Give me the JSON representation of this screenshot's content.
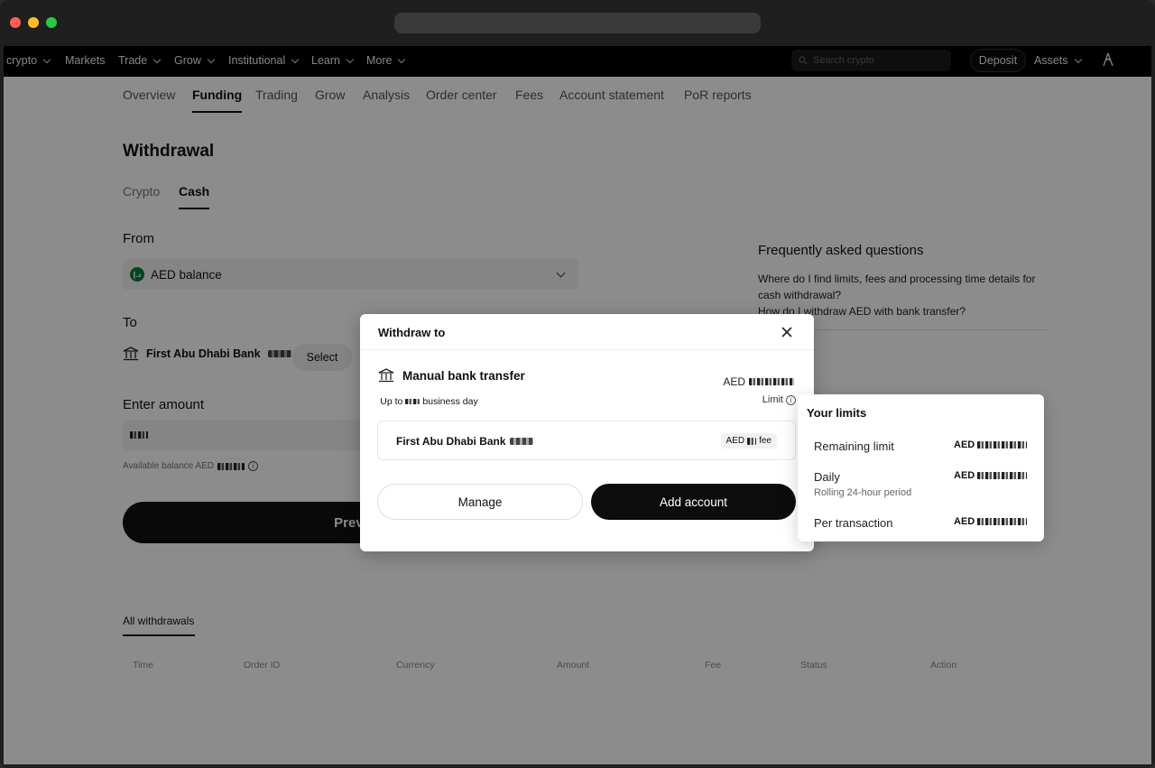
{
  "nav": {
    "items": [
      {
        "label": "crypto",
        "has_menu": true
      },
      {
        "label": "Markets",
        "has_menu": false
      },
      {
        "label": "Trade",
        "has_menu": true
      },
      {
        "label": "Grow",
        "has_menu": true
      },
      {
        "label": "Institutional",
        "has_menu": true
      },
      {
        "label": "Learn",
        "has_menu": true
      },
      {
        "label": "More",
        "has_menu": true
      }
    ],
    "search_placeholder": "Search crypto",
    "deposit_label": "Deposit",
    "assets_label": "Assets"
  },
  "subtabs": [
    {
      "label": "Overview",
      "active": false
    },
    {
      "label": "Funding",
      "active": true
    },
    {
      "label": "Trading",
      "active": false
    },
    {
      "label": "Grow",
      "active": false
    },
    {
      "label": "Analysis",
      "active": false
    },
    {
      "label": "Order center",
      "active": false
    },
    {
      "label": "Fees",
      "active": false
    },
    {
      "label": "Account statement",
      "active": false
    },
    {
      "label": "PoR reports",
      "active": false
    }
  ],
  "withdrawal": {
    "title": "Withdrawal",
    "tabs": [
      {
        "label": "Crypto",
        "active": false
      },
      {
        "label": "Cash",
        "active": true
      }
    ],
    "from_label": "From",
    "from_value": "AED balance",
    "to_label": "To",
    "to_bank": "First Abu Dhabi Bank",
    "select_label": "Select",
    "amount_label": "Enter amount",
    "available_label": "Available balance AED",
    "preview_label": "Previ"
  },
  "faq": {
    "title": "Frequently asked questions",
    "questions": [
      "Where do I find limits, fees and processing time details for cash withdrawal?",
      "How do I withdraw AED with bank transfer?"
    ]
  },
  "history": {
    "tab_label": "All withdrawals",
    "columns": [
      "Time",
      "Order ID",
      "Currency",
      "Amount",
      "Fee",
      "Status",
      "Action"
    ]
  },
  "modal": {
    "title": "Withdraw to",
    "method": "Manual bank transfer",
    "method_currency": "AED",
    "limit_label": "Limit",
    "bank_name": "First Abu Dhabi Bank",
    "fee_currency": "AED",
    "fee_label": "fee",
    "manage_label": "Manage",
    "add_account_label": "Add account"
  },
  "tooltip": {
    "prefix": "Up to",
    "suffix": "business day"
  },
  "limits": {
    "title": "Your limits",
    "rows": [
      {
        "label": "Remaining limit",
        "sub": "",
        "currency": "AED"
      },
      {
        "label": "Daily",
        "sub": "Rolling 24-hour period",
        "currency": "AED"
      },
      {
        "label": "Per transaction",
        "sub": "",
        "currency": "AED"
      }
    ]
  },
  "colors": {
    "primary": "#0c0c0c",
    "overlay": "#000000",
    "aed_badge": "#0f7a3d"
  }
}
